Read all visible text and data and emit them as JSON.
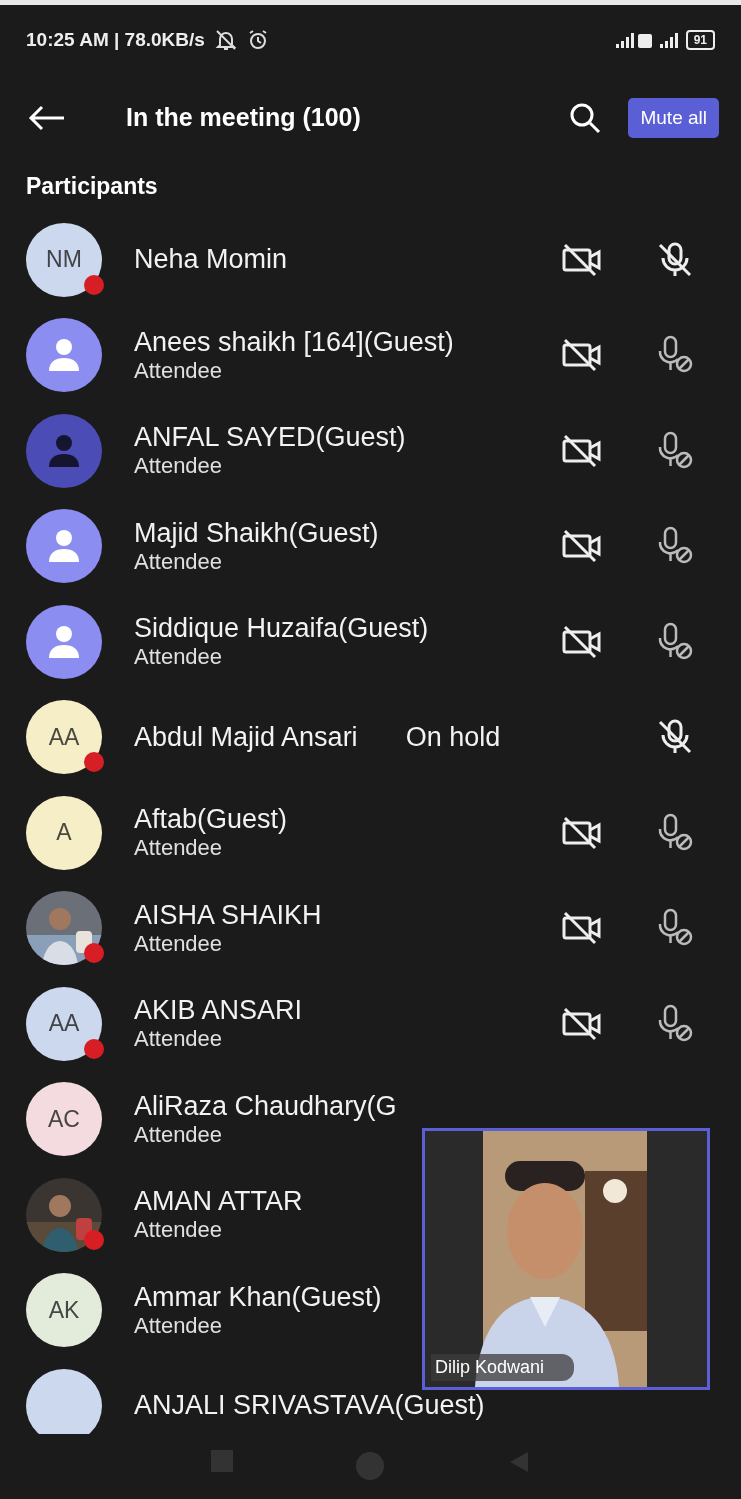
{
  "status_bar": {
    "time": "10:25 AM | 78.0KB/s",
    "battery": "91"
  },
  "header": {
    "title": "In the meeting (100)",
    "button": "Mute all"
  },
  "section_title": "Participants",
  "participants": [
    {
      "avatar": {
        "kind": "initials",
        "text": "NM",
        "color": "#cbd8ee"
      },
      "busy": true,
      "name": "Neha Momin",
      "video_off": true,
      "mic": {
        "kind": "muted"
      }
    },
    {
      "avatar": {
        "kind": "person",
        "color": "#8c8df0"
      },
      "busy": false,
      "name": "Anees shaikh [164](Guest)",
      "role": "Attendee",
      "video_off": true,
      "mic": {
        "kind": "blocked"
      }
    },
    {
      "avatar": {
        "kind": "person",
        "color": "#4c4cb6"
      },
      "busy": false,
      "name": "ANFAL SAYED(Guest)",
      "role": "Attendee",
      "video_off": true,
      "mic": {
        "kind": "blocked"
      }
    },
    {
      "avatar": {
        "kind": "person",
        "color": "#8c8df0"
      },
      "busy": false,
      "name": "Majid Shaikh(Guest)",
      "role": "Attendee",
      "video_off": true,
      "mic": {
        "kind": "blocked"
      }
    },
    {
      "avatar": {
        "kind": "person",
        "color": "#8c8df0"
      },
      "busy": false,
      "name": "Siddique Huzaifa(Guest)",
      "role": "Attendee",
      "video_off": true,
      "mic": {
        "kind": "blocked"
      }
    },
    {
      "avatar": {
        "kind": "initials",
        "text": "AA",
        "color": "#f6eec6"
      },
      "busy": true,
      "name": "Abdul Majid Ansari",
      "hold": "On hold",
      "video_off": false,
      "mic": {
        "kind": "muted"
      }
    },
    {
      "avatar": {
        "kind": "initials",
        "text": "A",
        "color": "#f6eec6"
      },
      "busy": false,
      "name": "Aftab(Guest)",
      "role": "Attendee",
      "video_off": true,
      "mic": {
        "kind": "blocked"
      }
    },
    {
      "busy": true,
      "name": "AISHA SHAIKH",
      "role": "Attendee",
      "video_off": true,
      "mic": {
        "kind": "blocked"
      }
    },
    {
      "avatar": {
        "kind": "initials",
        "text": "AA",
        "color": "#cbd8ee"
      },
      "busy": true,
      "name": "AKIB ANSARI",
      "role": "Attendee",
      "video_off": true,
      "mic": {
        "kind": "blocked"
      }
    },
    {
      "avatar": {
        "kind": "initials",
        "text": "AC",
        "color": "#f4dbe0"
      },
      "busy": false,
      "name": "AliRaza Chaudhary(G",
      "role": "Attendee"
    },
    {
      "busy": true,
      "name": "AMAN ATTAR",
      "role": "Attendee"
    },
    {
      "avatar": {
        "kind": "initials",
        "text": "AK",
        "color": "#e3ecdb"
      },
      "busy": false,
      "name": "Ammar Khan(Guest)",
      "role": "Attendee"
    },
    {
      "avatar": {
        "kind": "initials",
        "color": "#cbd8ee"
      },
      "busy": false,
      "name": "ANJALI SRIVASTAVA(Guest)"
    }
  ],
  "video_tile": {
    "name": "Dilip Kodwani"
  }
}
